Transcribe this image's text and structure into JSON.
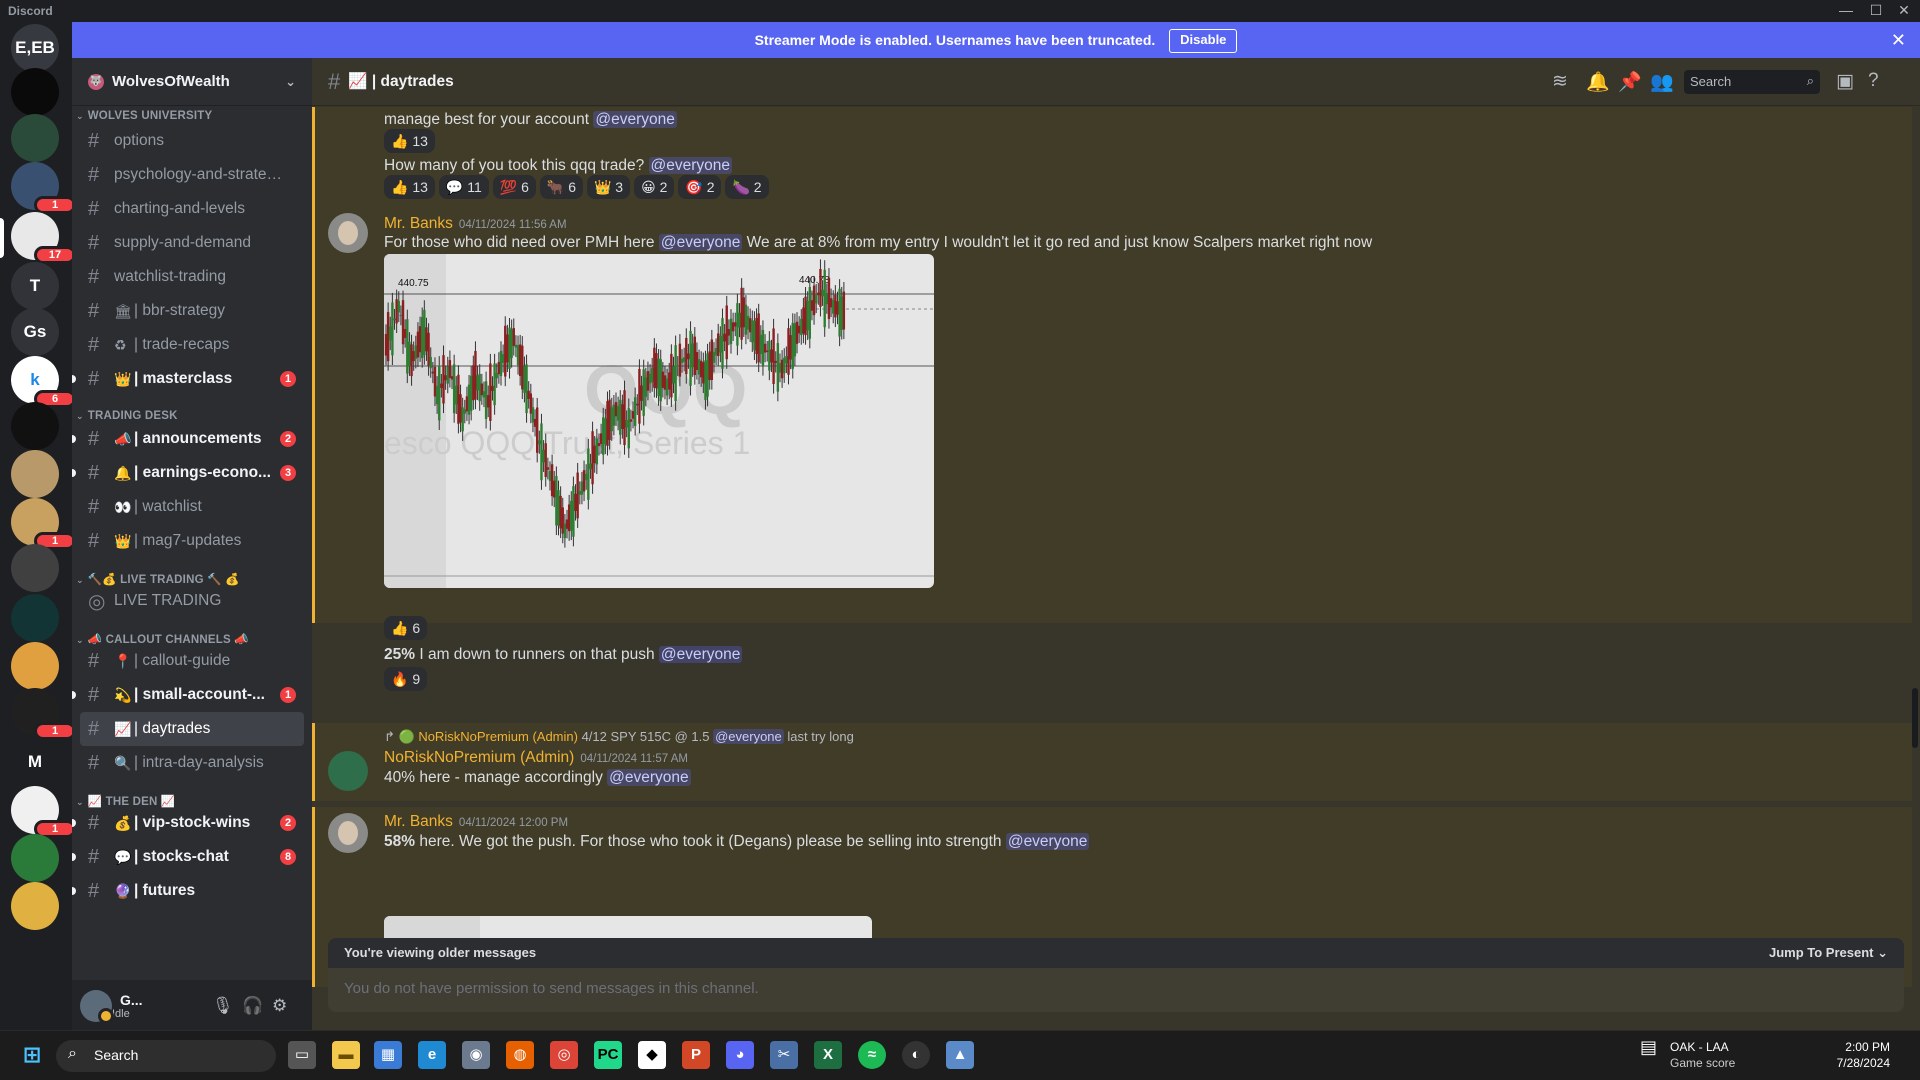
{
  "window": {
    "app_title": "Discord",
    "minimize": "—",
    "maximize": "☐",
    "close": "✕"
  },
  "banner": {
    "text": "Streamer Mode is enabled. Usernames have been truncated.",
    "button": "Disable",
    "close": "✕"
  },
  "guilds": [
    {
      "label": "E,EB",
      "color": "#36393f",
      "badge": ""
    },
    {
      "label": "",
      "color": "#0a0a0a",
      "badge": ""
    },
    {
      "label": "",
      "color": "#2a4a3a",
      "badge": ""
    },
    {
      "label": "",
      "color": "#3a5070",
      "badge": "1"
    },
    {
      "label": "",
      "color": "#e8e8e8",
      "badge": "17"
    },
    {
      "label": "T",
      "color": "#313338",
      "badge": ""
    },
    {
      "label": "Gs",
      "color": "#313338",
      "badge": ""
    },
    {
      "label": "k",
      "color": "#ffffff",
      "badge": "6"
    },
    {
      "label": "",
      "color": "#111111",
      "badge": ""
    },
    {
      "label": "",
      "color": "#b89a6a",
      "badge": ""
    },
    {
      "label": "",
      "color": "#c8a060",
      "badge": "1"
    },
    {
      "label": "",
      "color": "#404040",
      "badge": ""
    },
    {
      "label": "",
      "color": "#123434",
      "badge": ""
    },
    {
      "label": "",
      "color": "#e0a040",
      "badge": ""
    },
    {
      "label": "",
      "color": "#202020",
      "badge": "1"
    },
    {
      "label": "M",
      "color": "#1e1f22",
      "badge": ""
    },
    {
      "label": "",
      "color": "#f0f0f0",
      "badge": "1"
    },
    {
      "label": "",
      "color": "#2a7a3a",
      "badge": ""
    },
    {
      "label": "",
      "color": "#e0b040",
      "badge": ""
    }
  ],
  "server": {
    "name": "WolvesOfWealth"
  },
  "sections": [
    {
      "category": "WOLVES UNIVERSITY",
      "channels": [
        {
          "emoji": "",
          "name": "options",
          "unread": false,
          "badge": ""
        },
        {
          "emoji": "",
          "name": "psychology-and-strategi...",
          "unread": false,
          "badge": ""
        },
        {
          "emoji": "",
          "name": "charting-and-levels",
          "unread": false,
          "badge": ""
        },
        {
          "emoji": "",
          "name": "supply-and-demand",
          "unread": false,
          "badge": ""
        },
        {
          "emoji": "",
          "name": "watchlist-trading",
          "unread": false,
          "badge": ""
        },
        {
          "emoji": "🏛",
          "name": "| bbr-strategy",
          "unread": false,
          "badge": ""
        },
        {
          "emoji": "♻",
          "name": "| trade-recaps",
          "unread": false,
          "badge": ""
        },
        {
          "emoji": "👑",
          "name": "| masterclass",
          "unread": true,
          "badge": "1"
        }
      ]
    },
    {
      "category": "TRADING DESK",
      "channels": [
        {
          "emoji": "📣",
          "name": "| announcements",
          "unread": true,
          "badge": "2"
        },
        {
          "emoji": "🔔",
          "name": "| earnings-econo...",
          "unread": true,
          "badge": "3"
        },
        {
          "emoji": "👀",
          "name": "| watchlist",
          "unread": false,
          "badge": ""
        },
        {
          "emoji": "👑",
          "name": "| mag7-updates",
          "unread": false,
          "badge": ""
        }
      ]
    },
    {
      "category": "🔨💰 LIVE TRADING 🔨 💰",
      "channels": [
        {
          "emoji": "",
          "name": "LIVE TRADING",
          "unread": false,
          "badge": "",
          "voice": true
        }
      ]
    },
    {
      "category": "📣 CALLOUT CHANNELS 📣",
      "channels": [
        {
          "emoji": "📍",
          "name": "| callout-guide",
          "unread": false,
          "badge": ""
        },
        {
          "emoji": "💫",
          "name": "| small-account-...",
          "unread": true,
          "badge": "1"
        },
        {
          "emoji": "📈",
          "name": "| daytrades",
          "unread": false,
          "badge": "",
          "active": true
        },
        {
          "emoji": "🔍",
          "name": "| intra-day-analysis",
          "unread": false,
          "badge": ""
        }
      ]
    },
    {
      "category": "📈 THE DEN 📈",
      "channels": [
        {
          "emoji": "💰",
          "name": "| vip-stock-wins",
          "unread": true,
          "badge": "2"
        },
        {
          "emoji": "💬",
          "name": "| stocks-chat",
          "unread": true,
          "badge": "8"
        },
        {
          "emoji": "🔮",
          "name": "| futures",
          "unread": true,
          "badge": ""
        }
      ]
    }
  ],
  "user": {
    "name": "G...",
    "status": "Idle"
  },
  "header": {
    "channel": "📈 | daytrades",
    "search_placeholder": "Search"
  },
  "messages": {
    "m0": {
      "text": "manage best for your account",
      "mention": "@everyone",
      "reactions": [
        "👍 13"
      ]
    },
    "m1": {
      "text": "How many of you took this qqq trade?",
      "mention": "@everyone",
      "reactions": [
        "👍 13",
        "💬 11",
        "💯 6",
        "🐂 6",
        "👑 3",
        "😀 2",
        "🎯 2",
        "🍆 2"
      ]
    },
    "m2": {
      "author": "Mr. Banks",
      "timestamp": "04/11/2024 11:56 AM",
      "text": "For those who did need over PMH here",
      "mention": "@everyone",
      "text_after": "We are at 8% from my entry I wouldn't let it go red and just know Scalpers market right now",
      "chart_label_left": "440.75",
      "chart_label_right": "440.78",
      "watermark_1": "QQQ",
      "watermark_2": "esco QQQ Trust, Series 1",
      "reactions": [
        "👍 6"
      ]
    },
    "m3": {
      "bold": "25%",
      "text": "I am down to runners on that push",
      "mention": "@everyone",
      "reactions": [
        "🔥 9"
      ]
    },
    "m4": {
      "reply_author": "NoRiskNoPremium (Admin)",
      "reply_text": "4/12 SPY 515C @ 1.5",
      "reply_mention": "@everyone",
      "reply_after": "last try long",
      "author": "NoRiskNoPremium (Admin)",
      "timestamp": "04/11/2024 11:57 AM",
      "text": "40% here - manage accordingly",
      "mention": "@everyone"
    },
    "m5": {
      "author": "Mr. Banks",
      "timestamp": "04/11/2024 12:00 PM",
      "bold": "58%",
      "text": "here. We got the push. For those who took it (Degans) please be selling into strength",
      "mention": "@everyone"
    }
  },
  "older": {
    "label": "You're viewing older messages",
    "jump": "Jump To Present"
  },
  "composer": {
    "placeholder": "You do not have permission to send messages in this channel."
  },
  "taskbar": {
    "search": "Search",
    "weather_title": "OAK - LAA",
    "weather_sub": "Game score",
    "time": "2:00 PM",
    "date": "7/28/2024"
  },
  "chart_data": {
    "type": "line",
    "series": [
      {
        "values": [
          440.1,
          440.6,
          439.9,
          440.3,
          439.5,
          439.8,
          439.2,
          439.7,
          439.4,
          439.9,
          440.2,
          439.6,
          438.9,
          438.4,
          437.8,
          438.2,
          438.6,
          439.0,
          439.3,
          439.1,
          439.5,
          439.8,
          439.6,
          439.9,
          440.0,
          439.7,
          440.1,
          440.3,
          440.5,
          440.2,
          440.0,
          439.8,
          440.2,
          440.5,
          440.8,
          440.6,
          440.5
        ]
      }
    ],
    "ylim": [
      437.5,
      441.0
    ]
  }
}
